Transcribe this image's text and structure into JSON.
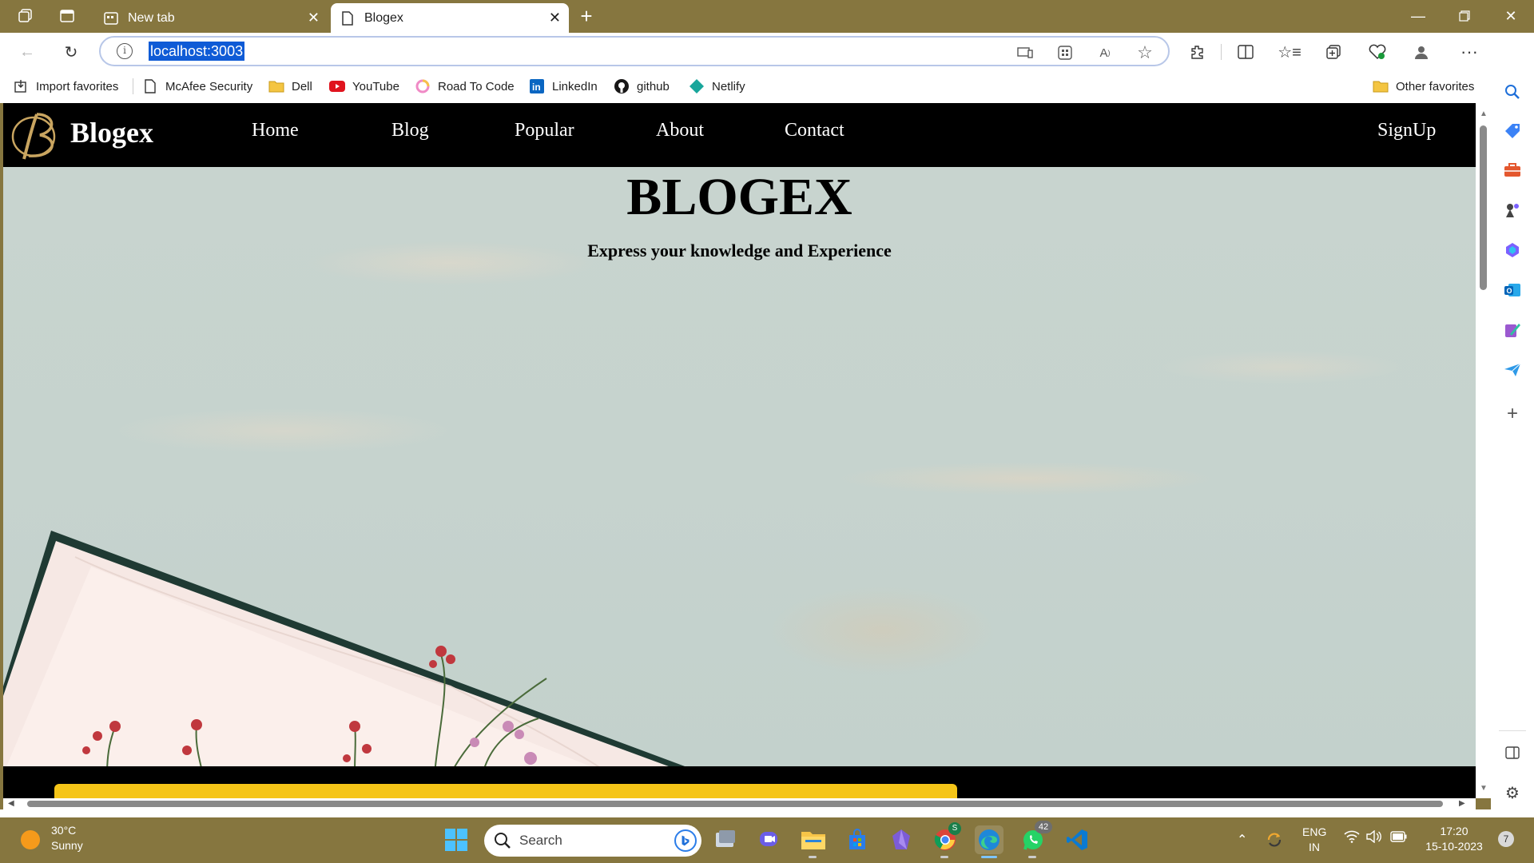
{
  "browser": {
    "tabs": [
      {
        "title": "New tab",
        "active": false
      },
      {
        "title": "Blogex",
        "active": true
      }
    ],
    "url": "localhost:3003",
    "favorites": [
      {
        "label": "Import favorites",
        "icon": "import-icon"
      },
      {
        "label": "McAfee Security",
        "icon": "page-icon"
      },
      {
        "label": "Dell",
        "icon": "folder-icon"
      },
      {
        "label": "YouTube",
        "icon": "youtube-icon"
      },
      {
        "label": "Road To Code",
        "icon": "roadtocode-icon"
      },
      {
        "label": "LinkedIn",
        "icon": "linkedin-icon"
      },
      {
        "label": "github",
        "icon": "github-icon"
      },
      {
        "label": "Netlify",
        "icon": "netlify-icon"
      }
    ],
    "other_favorites": "Other favorites"
  },
  "site": {
    "brand": "Blogex",
    "nav": [
      "Home",
      "Blog",
      "Popular",
      "About",
      "Contact"
    ],
    "signup": "SignUp",
    "hero_title": "BLOGEX",
    "hero_subtitle": "Express your knowledge and Experience"
  },
  "taskbar": {
    "weather_temp": "30°C",
    "weather_desc": "Sunny",
    "search_placeholder": "Search",
    "whatsapp_badge": "42",
    "chrome_badge": "S",
    "lang_1": "ENG",
    "lang_2": "IN",
    "time": "17:20",
    "date": "15-10-2023",
    "notification_count": "7"
  },
  "colors": {
    "titlebar": "#86763f",
    "url_highlight": "#0f5bd6",
    "site_nav": "#000000",
    "hero_bg": "#c6d3ce",
    "accent_yellow": "#f5c518"
  }
}
